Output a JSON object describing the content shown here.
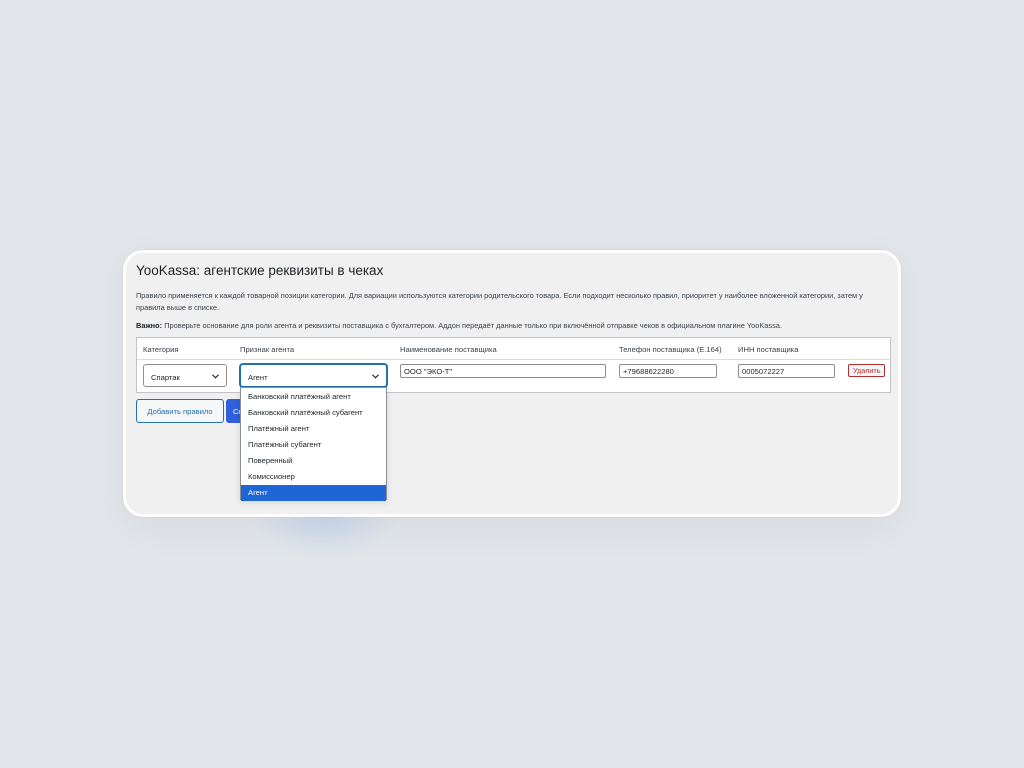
{
  "page": {
    "title": "YooKassa: агентские реквизиты в чеках",
    "description": "Правило применяется к каждой товарной позиции категории. Для вариации используются категории родительского товара. Если подходит несколько правил, приоритет у наиболее вложенной категории, затем у правила выше в списке.",
    "note_label": "Важно:",
    "note_text": " Проверьте основание для роли агента и реквизиты поставщика с бухгалтером. Аддон передаёт данные только при включённой отправке чеков в официальном плагине YooKassa."
  },
  "table": {
    "columns": [
      "Категория",
      "Признак агента",
      "Наименование поставщика",
      "Телефон поставщика (E.164)",
      "ИНН поставщика"
    ],
    "rows": [
      {
        "category": "Спартак",
        "agent_type": "Агент",
        "supplier_name": "ООО \"ЭКО-Т\"",
        "supplier_phone": "+79688622280",
        "supplier_inn": "0005072227",
        "delete_label": "Удалить"
      }
    ]
  },
  "agent_dropdown": {
    "options": [
      "Банковский платёжный агент",
      "Банковский платёжный субагент",
      "Платёжный агент",
      "Платёжный субагент",
      "Поверенный",
      "Комиссионер",
      "Агент"
    ],
    "selected": "Агент"
  },
  "actions": {
    "add_rule_label": "Добавить правило",
    "save_label": "Сохранить"
  },
  "colors": {
    "primary": "#2271b1",
    "save_button": "#2f5fde",
    "danger": "#b32d2e",
    "option_selected": "#1e66d6"
  }
}
